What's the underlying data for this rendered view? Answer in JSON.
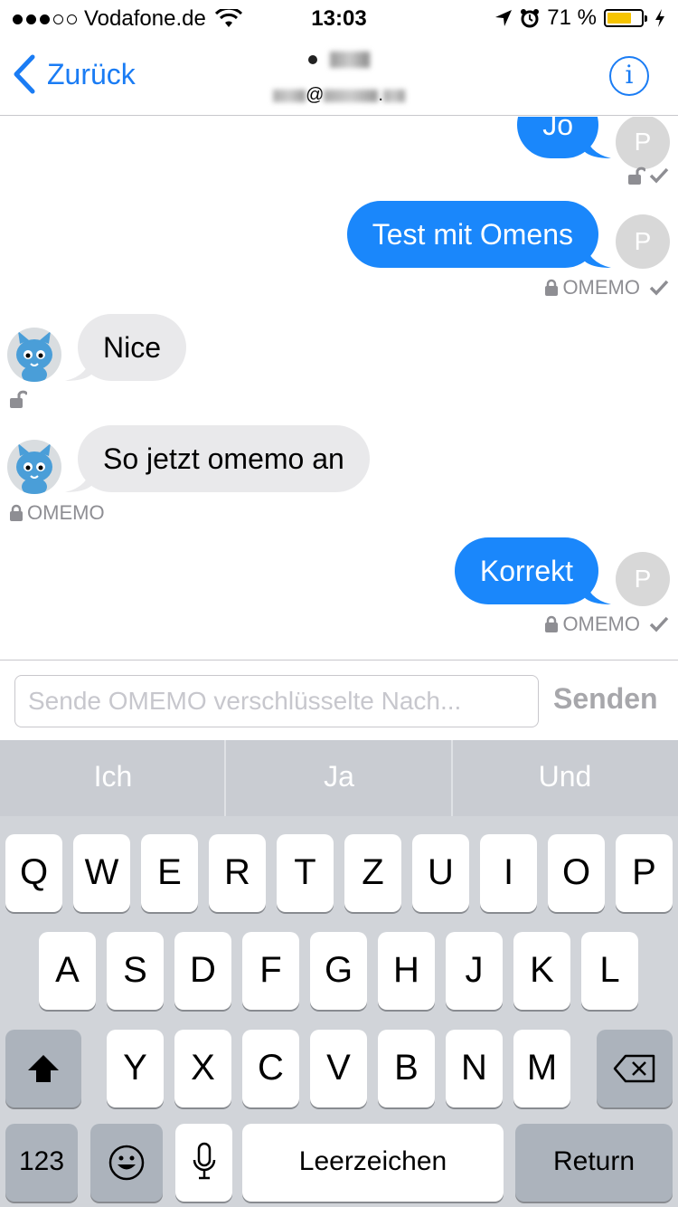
{
  "status_bar": {
    "carrier": "Vodafone.de",
    "time": "13:03",
    "battery_percent": "71 %",
    "battery_level": 0.71,
    "battery_color": "#f6c400"
  },
  "nav": {
    "back_label": "Zurück",
    "contact_at": "@",
    "contact_suffix": ".",
    "info_glyph": "i",
    "accent_color": "#1a7cf4"
  },
  "messages": [
    {
      "direction": "out",
      "text": "Jo",
      "avatar": "P",
      "meta": ""
    },
    {
      "direction": "out",
      "text": "Test mit Omens",
      "avatar": "P",
      "meta": "OMEMO"
    },
    {
      "direction": "in",
      "text": "Nice",
      "meta": ""
    },
    {
      "direction": "in",
      "text": "So jetzt omemo an",
      "meta": "OMEMO"
    },
    {
      "direction": "out",
      "text": "Korrekt",
      "avatar": "P",
      "meta": "OMEMO"
    }
  ],
  "composer": {
    "placeholder": "Sende OMEMO verschlüsselte Nach...",
    "send_label": "Senden"
  },
  "keyboard": {
    "suggestions": [
      "Ich",
      "Ja",
      "Und"
    ],
    "row1": [
      "Q",
      "W",
      "E",
      "R",
      "T",
      "Z",
      "U",
      "I",
      "O",
      "P"
    ],
    "row2": [
      "A",
      "S",
      "D",
      "F",
      "G",
      "H",
      "J",
      "K",
      "L"
    ],
    "row3": [
      "Y",
      "X",
      "C",
      "V",
      "B",
      "N",
      "M"
    ],
    "numbers_label": "123",
    "space_label": "Leerzeichen",
    "return_label": "Return"
  }
}
